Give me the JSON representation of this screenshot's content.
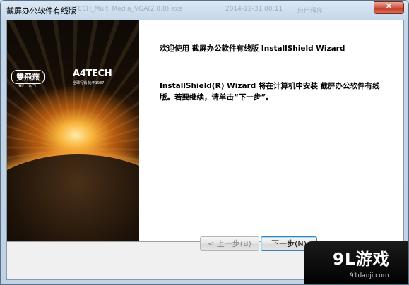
{
  "window": {
    "title": "截屏办公软件有线版",
    "background_ghost": {
      "filename": "A4TECH_Multi Media_VGA(2.0.0).exe",
      "date": "2014-12-31 00:11",
      "kind": "应用程序"
    },
    "close_glyph": "✕"
  },
  "banner": {
    "left_logo_mark": "雙飛燕",
    "left_logo_slogan": "我们一起飞",
    "right_logo_brand": "A4TECH",
    "right_logo_sub": "全球行销  始于1987"
  },
  "wizard": {
    "heading": "欢迎使用 截屏办公软件有线版 InstallShield Wizard",
    "body": "InstallShield(R) Wizard 将在计算机中安装 截屏办公软件有线版。若要继续，请单击“下一步”。"
  },
  "buttons": {
    "back": "< 上一步(B)",
    "next": "下一步(N)"
  },
  "watermark": {
    "logo": "9L游戏",
    "site": "91danji.com"
  },
  "colors": {
    "window_frame": "#c3d5e8",
    "close_button": "#c2361f",
    "banner_glow": "#ffba3c",
    "watermark_bg": "#000000"
  }
}
